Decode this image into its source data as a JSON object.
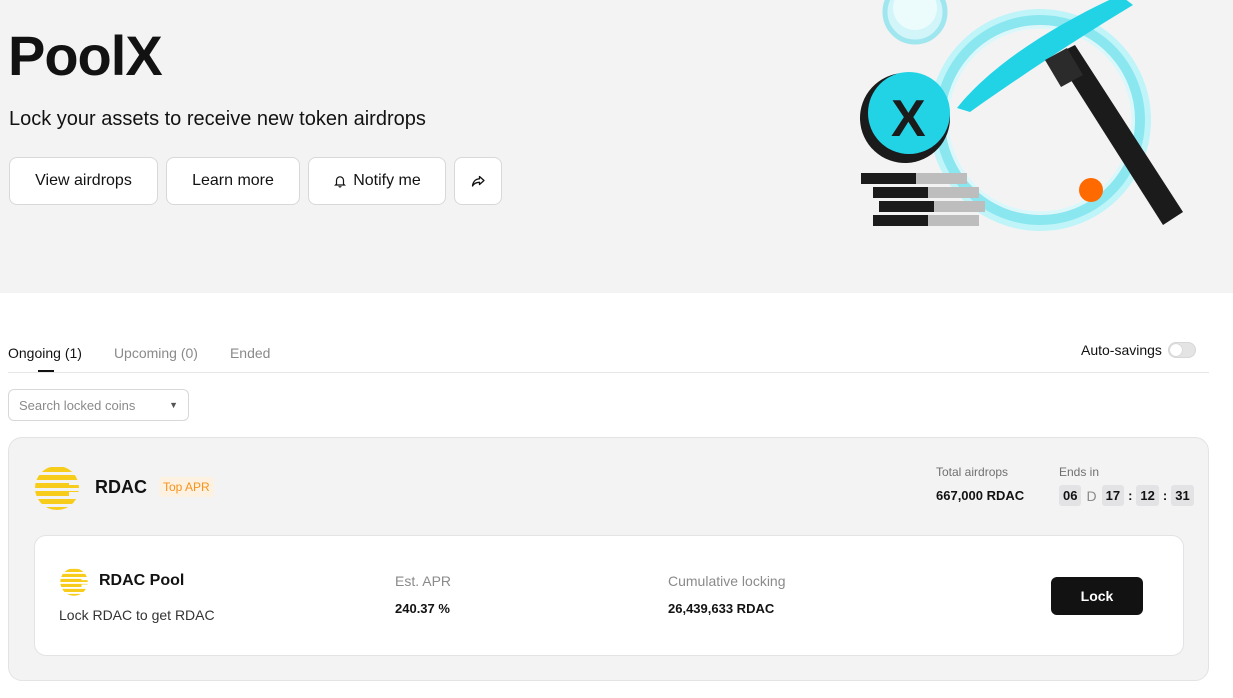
{
  "hero": {
    "title": "PoolX",
    "subtitle": "Lock your assets to receive new token airdrops",
    "buttons": {
      "view_airdrops": "View airdrops",
      "learn_more": "Learn more",
      "notify_me": "Notify me"
    },
    "illustration_logo_letter": "X"
  },
  "tabs": [
    {
      "label": "Ongoing (1)",
      "active": true
    },
    {
      "label": "Upcoming (0)",
      "active": false
    },
    {
      "label": "Ended",
      "active": false
    }
  ],
  "auto_savings": {
    "label": "Auto-savings",
    "enabled": false
  },
  "search": {
    "placeholder": "Search locked coins"
  },
  "project": {
    "coin": "RDAC",
    "badge": "Top APR",
    "total_airdrops_label": "Total airdrops",
    "total_airdrops_value": "667,000 RDAC",
    "ends_in_label": "Ends in",
    "countdown": {
      "days": "06",
      "day_unit": "D",
      "hours": "17",
      "minutes": "12",
      "seconds": "31",
      "separator": ":"
    },
    "pool": {
      "name": "RDAC Pool",
      "description": "Lock RDAC to get RDAC",
      "apr_label": "Est. APR",
      "apr_value": "240.37 %",
      "cumulative_label": "Cumulative locking",
      "cumulative_value": "26,439,633 RDAC",
      "action_label": "Lock"
    }
  },
  "colors": {
    "hero_bg": "#f3f3f4",
    "accent_cyan": "#22d3e6",
    "accent_orange": "#ff6a00",
    "coin_yellow": "#f8cc1b",
    "badge_orange": "#f7931a",
    "primary_dark": "#121212"
  },
  "icons": {
    "notify": "bell-icon",
    "share": "share-icon",
    "dropdown": "caret-down-icon",
    "coin": "rdac-coin-icon"
  }
}
